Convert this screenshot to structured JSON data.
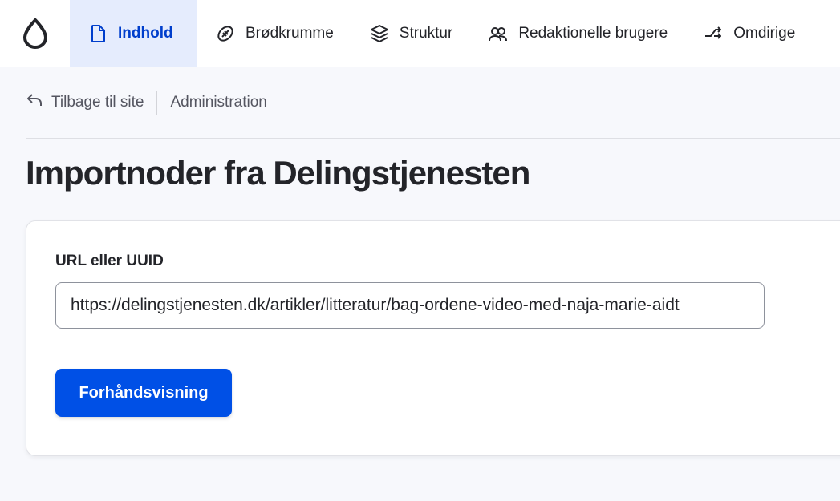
{
  "topbar": {
    "logo_icon": "drupal-drop-icon",
    "items": [
      {
        "label": "Indhold",
        "icon": "file-icon",
        "active": true
      },
      {
        "label": "Brødkrumme",
        "icon": "football-icon",
        "active": false
      },
      {
        "label": "Struktur",
        "icon": "layers-icon",
        "active": false
      },
      {
        "label": "Redaktionelle brugere",
        "icon": "users-icon",
        "active": false
      },
      {
        "label": "Omdirige",
        "icon": "redirect-icon",
        "active": false
      }
    ]
  },
  "breadcrumb": {
    "back_label": "Tilbage til site",
    "back_icon": "back-arrow-icon",
    "current": "Administration"
  },
  "page": {
    "title": "Importnoder fra Delingstjenesten"
  },
  "form": {
    "url_label": "URL eller UUID",
    "url_value": "https://delingstjenesten.dk/artikler/litteratur/bag-ordene-video-med-naja-marie-aidt",
    "preview_button": "Forhåndsvisning"
  },
  "colors": {
    "accent": "#0050e6",
    "active_nav_bg": "#e5ecfd",
    "active_nav_text": "#003ecc",
    "page_bg": "#f7f8fc"
  }
}
